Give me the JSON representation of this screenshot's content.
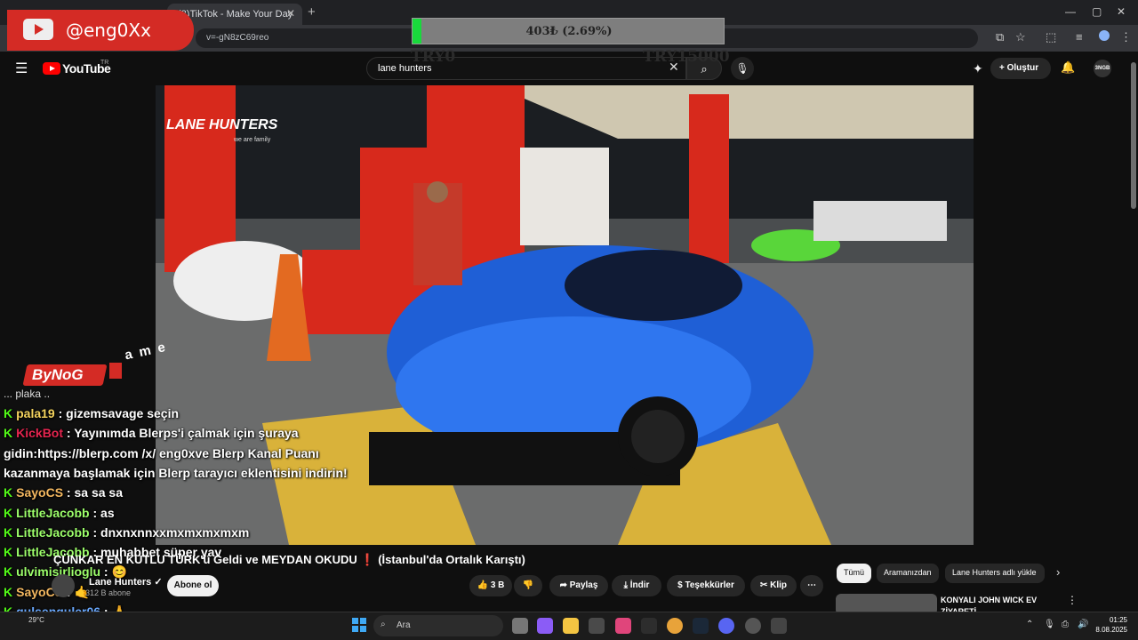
{
  "browser": {
    "tab_title": "(3)TikTok - Make Your Day",
    "url": "v=-gN8zC69reo"
  },
  "youtube": {
    "logo_text": "YouTube",
    "region": "TR",
    "search_value": "lane hunters",
    "create_label": "Oluştur"
  },
  "overlay": {
    "streamer_handle": "@eng0Xx",
    "donation_text": "403₺ (2.69%)",
    "donation_progress": 0.0269,
    "donation_min": "TRY0",
    "donation_max": "TRY15000",
    "sponsor_text": "ByNoG",
    "sponsor_suffix": "ame"
  },
  "video": {
    "watermark_title": "LANE HUNTERS",
    "watermark_sub": "we are family",
    "title": "ÇÜNKAR EN KUTLU TÜRK'ü Geldi ve MEYDAN OKUDU ❗ (İstanbul'da Ortalık Karıştı)",
    "channel_name": "Lane Hunters",
    "subscribers": "312 B abone",
    "subscribe_label": "Abone ol",
    "likes": "3 B",
    "share_label": "Paylaş",
    "download_label": "İndir",
    "thanks_label": "Teşekkürler",
    "clip_label": "Klip"
  },
  "chat": {
    "partial_top": "... plaka ..",
    "messages": [
      {
        "user": "pala19",
        "user_color": "#f4d35e",
        "text": " : gizemsavage seçin"
      },
      {
        "user": "KickBot",
        "user_color": "#e5254f",
        "text": " : Yayınımda Blerps'i çalmak için şuraya"
      },
      {
        "user": "",
        "user_color": "#ffffff",
        "text": "gidin:https://blerp.com /x/ eng0xve Blerp Kanal Puanı"
      },
      {
        "user": "",
        "user_color": "#ffffff",
        "text": "kazanmaya başlamak için Blerp tarayıcı eklentisini indirin!"
      },
      {
        "user": "SayoCS",
        "user_color": "#f4b860",
        "text": " : sa sa sa"
      },
      {
        "user": "LittleJacobb",
        "user_color": "#9dff6b",
        "text": " : as"
      },
      {
        "user": "LittleJacobb",
        "user_color": "#9dff6b",
        "text": " : dnxnxnnxxmxmxmxmxm"
      },
      {
        "user": "LittleJacobb",
        "user_color": "#9dff6b",
        "text": " : muhabbet süper yav"
      },
      {
        "user": "ulvimisirlioglu",
        "user_color": "#9dff6b",
        "text": " : 😊"
      },
      {
        "user": "SayoCS",
        "user_color": "#f4b860",
        "text": " : 🤙"
      },
      {
        "user": "gulsenguler06",
        "user_color": "#6aa9ff",
        "text": " : 🙏"
      }
    ]
  },
  "sidebar": {
    "chips": [
      "Tümü",
      "Aramanızdan",
      "Lane Hunters adlı yükle"
    ],
    "rec_title": "KONYALI JOHN WICK EV ZİYARETİ"
  },
  "taskbar": {
    "search_placeholder": "Ara",
    "weather": "29°C",
    "time": "01:25",
    "date": "8.08.2025"
  }
}
